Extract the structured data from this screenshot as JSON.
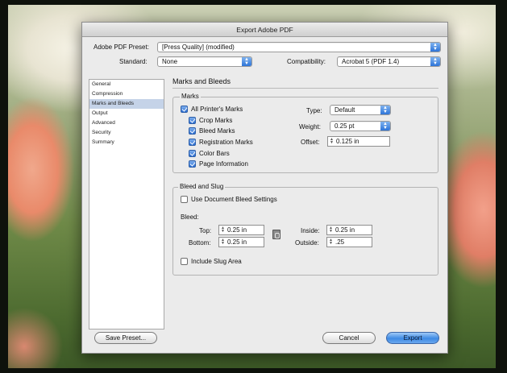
{
  "window": {
    "title": "Export Adobe PDF"
  },
  "preset": {
    "label": "Adobe PDF Preset:",
    "value": "[Press Quality] (modified)"
  },
  "standard": {
    "label": "Standard:",
    "value": "None"
  },
  "compatibility": {
    "label": "Compatibility:",
    "value": "Acrobat 5 (PDF 1.4)"
  },
  "sidebar": {
    "items": [
      {
        "label": "General"
      },
      {
        "label": "Compression"
      },
      {
        "label": "Marks and Bleeds"
      },
      {
        "label": "Output"
      },
      {
        "label": "Advanced"
      },
      {
        "label": "Security"
      },
      {
        "label": "Summary"
      }
    ]
  },
  "section": {
    "title": "Marks and Bleeds"
  },
  "marks": {
    "group_title": "Marks",
    "all_printers_marks": "All Printer's Marks",
    "crop_marks": "Crop Marks",
    "bleed_marks": "Bleed Marks",
    "registration_marks": "Registration Marks",
    "color_bars": "Color Bars",
    "page_information": "Page Information",
    "type_label": "Type:",
    "type_value": "Default",
    "weight_label": "Weight:",
    "weight_value": "0.25 pt",
    "offset_label": "Offset:",
    "offset_value": "0.125 in"
  },
  "bleed": {
    "group_title": "Bleed and Slug",
    "use_document_bleed": "Use Document Bleed Settings",
    "bleed_label": "Bleed:",
    "top_label": "Top:",
    "top_value": "0.25 in",
    "bottom_label": "Bottom:",
    "bottom_value": "0.25 in",
    "inside_label": "Inside:",
    "inside_value": "0.25 in",
    "outside_label": "Outside:",
    "outside_value": ".25",
    "include_slug": "Include Slug Area"
  },
  "buttons": {
    "save_preset": "Save Preset...",
    "cancel": "Cancel",
    "export": "Export"
  },
  "colors": {
    "accent": "#3f8ae4",
    "sidebar_selection": "#c5d3e8",
    "dialog_bg": "#ebebeb"
  }
}
